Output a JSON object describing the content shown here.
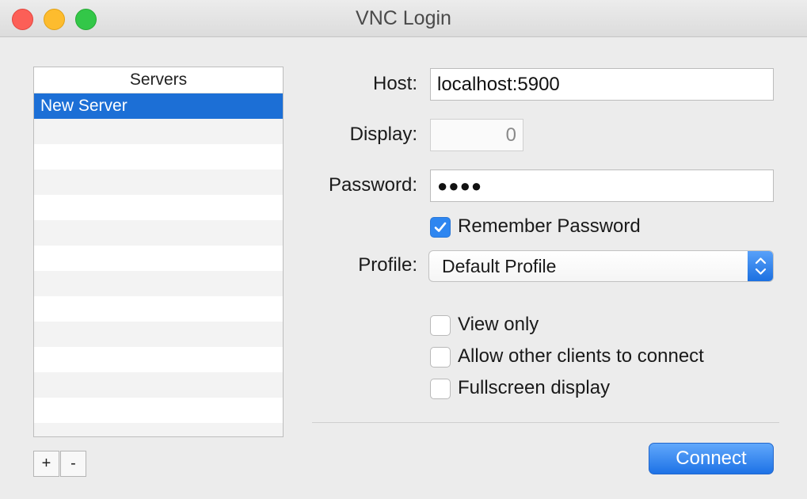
{
  "window": {
    "title": "VNC Login"
  },
  "servers": {
    "header": "Servers",
    "items": [
      "New Server"
    ],
    "selected_index": 0,
    "add_label": "+",
    "remove_label": "-"
  },
  "form": {
    "host_label": "Host:",
    "host_value": "localhost:5900",
    "display_label": "Display:",
    "display_value": "0",
    "password_label": "Password:",
    "password_value": "●●●●",
    "remember_password": {
      "label": "Remember Password",
      "checked": true
    },
    "profile_label": "Profile:",
    "profile_value": "Default Profile"
  },
  "options": [
    {
      "label": "View only",
      "checked": false
    },
    {
      "label": "Allow other clients to connect",
      "checked": false
    },
    {
      "label": "Fullscreen display",
      "checked": false
    }
  ],
  "actions": {
    "connect_label": "Connect"
  },
  "colors": {
    "accent": "#1c6fd6",
    "button": "#2e86f0"
  }
}
